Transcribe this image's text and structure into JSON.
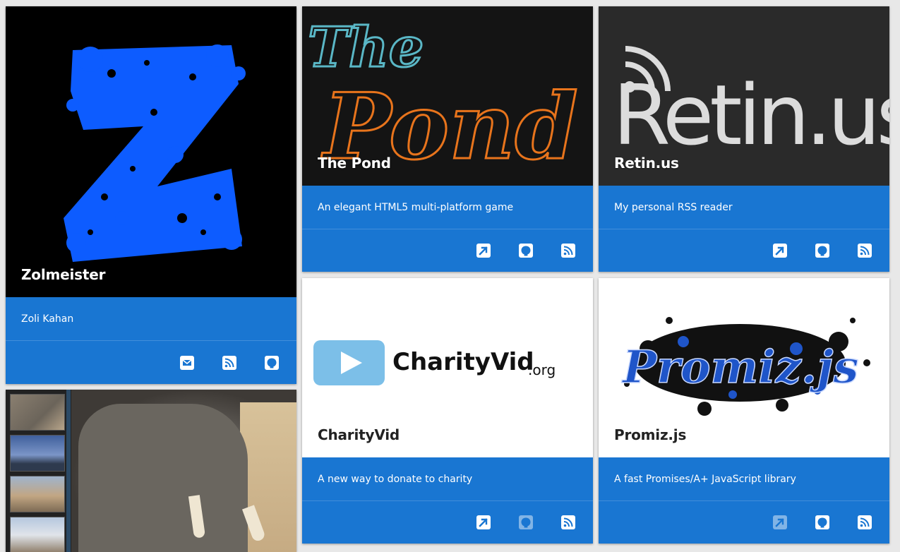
{
  "cards": [
    {
      "id": "zolmeister",
      "title": "Zolmeister",
      "description": "Zoli Kahan",
      "actions": [
        {
          "icon": "mail-icon",
          "enabled": true
        },
        {
          "icon": "rss-icon",
          "enabled": true
        },
        {
          "icon": "github-icon",
          "enabled": true
        }
      ]
    },
    {
      "id": "the-pond",
      "title": "The Pond",
      "logo_text_top": "The",
      "logo_text_bottom": "Pond",
      "description": "An elegant HTML5 multi-platform game",
      "actions": [
        {
          "icon": "external-link-icon",
          "enabled": true
        },
        {
          "icon": "github-icon",
          "enabled": true
        },
        {
          "icon": "rss-icon",
          "enabled": true
        }
      ]
    },
    {
      "id": "retinus",
      "title": "Retin.us",
      "logo_text": "Retin.us",
      "description": "My personal RSS reader",
      "actions": [
        {
          "icon": "external-link-icon",
          "enabled": true
        },
        {
          "icon": "github-icon",
          "enabled": true
        },
        {
          "icon": "rss-icon",
          "enabled": true
        }
      ]
    },
    {
      "id": "charityvid",
      "title": "CharityVid",
      "logo_text": "CharityVid",
      "logo_suffix": ".org",
      "description": "A new way to donate to charity",
      "actions": [
        {
          "icon": "external-link-icon",
          "enabled": true
        },
        {
          "icon": "github-icon",
          "enabled": false
        },
        {
          "icon": "rss-icon",
          "enabled": true
        }
      ]
    },
    {
      "id": "promizjs",
      "title": "Promiz.js",
      "logo_text": "Promiz.js",
      "description": "A fast Promises/A+ JavaScript library",
      "actions": [
        {
          "icon": "external-link-icon",
          "enabled": false
        },
        {
          "icon": "github-icon",
          "enabled": true
        },
        {
          "icon": "rss-icon",
          "enabled": true
        }
      ]
    },
    {
      "id": "gallery",
      "title": "",
      "description": "",
      "actions": []
    }
  ],
  "colors": {
    "card_blue": "#1976d2",
    "z_blue": "#0d5cff",
    "pond_orange": "#e8741c",
    "pond_teal": "#5ab7c6"
  }
}
